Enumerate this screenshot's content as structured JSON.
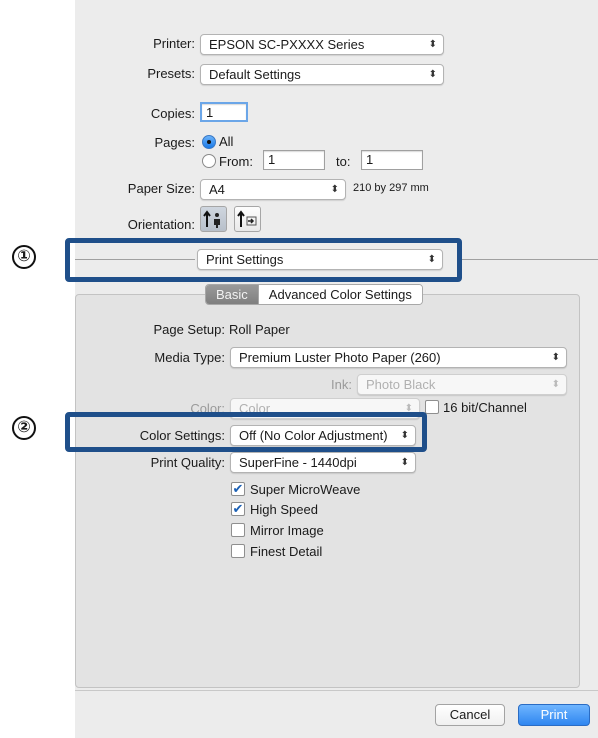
{
  "printer": {
    "label": "Printer:",
    "value": "EPSON SC-PXXXX Series"
  },
  "presets": {
    "label": "Presets:",
    "value": "Default Settings"
  },
  "copies": {
    "label": "Copies:",
    "value": "1"
  },
  "pages": {
    "label": "Pages:",
    "all_label": "All",
    "from_label": "From:",
    "from_value": "1",
    "to_label": "to:",
    "to_value": "1"
  },
  "paper_size": {
    "label": "Paper Size:",
    "value": "A4",
    "dimensions": "210 by 297 mm"
  },
  "orientation": {
    "label": "Orientation:"
  },
  "section_popup": {
    "value": "Print Settings"
  },
  "tabs": [
    {
      "label": "Basic"
    },
    {
      "label": "Advanced Color Settings"
    }
  ],
  "settings": {
    "page_setup_label": "Page Setup:",
    "page_setup_value": "Roll Paper",
    "media_type_label": "Media Type:",
    "media_type_value": "Premium Luster Photo Paper (260)",
    "ink_label": "Ink:",
    "ink_value": "Photo Black",
    "color_label": "Color:",
    "color_value": "Color",
    "bit_label": "16 bit/Channel",
    "color_settings_label": "Color Settings:",
    "color_settings_value": "Off (No Color Adjustment)",
    "print_quality_label": "Print Quality:",
    "print_quality_value": "SuperFine - 1440dpi"
  },
  "options": [
    {
      "label": "Super MicroWeave",
      "checked": true
    },
    {
      "label": "High Speed",
      "checked": true
    },
    {
      "label": "Mirror Image",
      "checked": false
    },
    {
      "label": "Finest Detail",
      "checked": false
    }
  ],
  "buttons": {
    "cancel": "Cancel",
    "print": "Print"
  },
  "callouts": {
    "one": "①",
    "two": "②"
  },
  "colors": {
    "highlight": "#1f4f8a",
    "accent": "#2f86f0"
  }
}
